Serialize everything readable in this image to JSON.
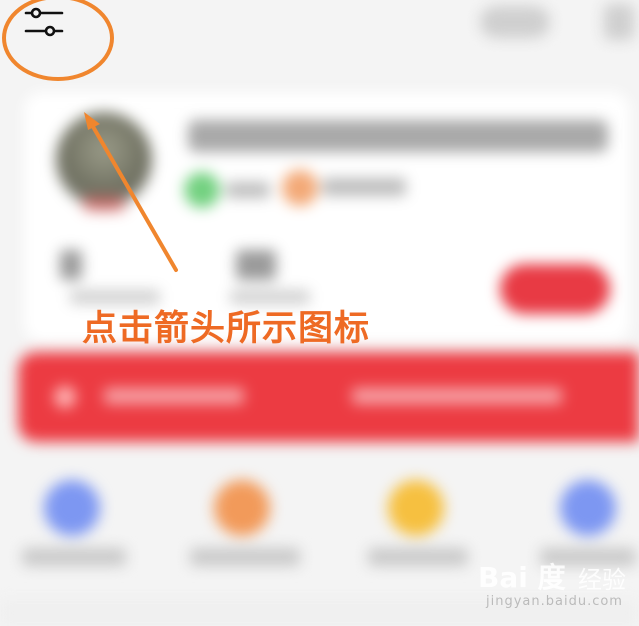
{
  "settings_icon": {
    "icon": "sliders-icon"
  },
  "annotation": {
    "text": "点击箭头所示图标",
    "color": "#ee6a24"
  },
  "watermark": {
    "logo": "Bai 度",
    "brand_cn": "经验",
    "url": "jingyan.baidu.com"
  },
  "colors": {
    "accent_red": "#ec3b42",
    "feature_icons": [
      "#7d97f2",
      "#f29a5a",
      "#f6c040",
      "#7d97f2"
    ]
  }
}
